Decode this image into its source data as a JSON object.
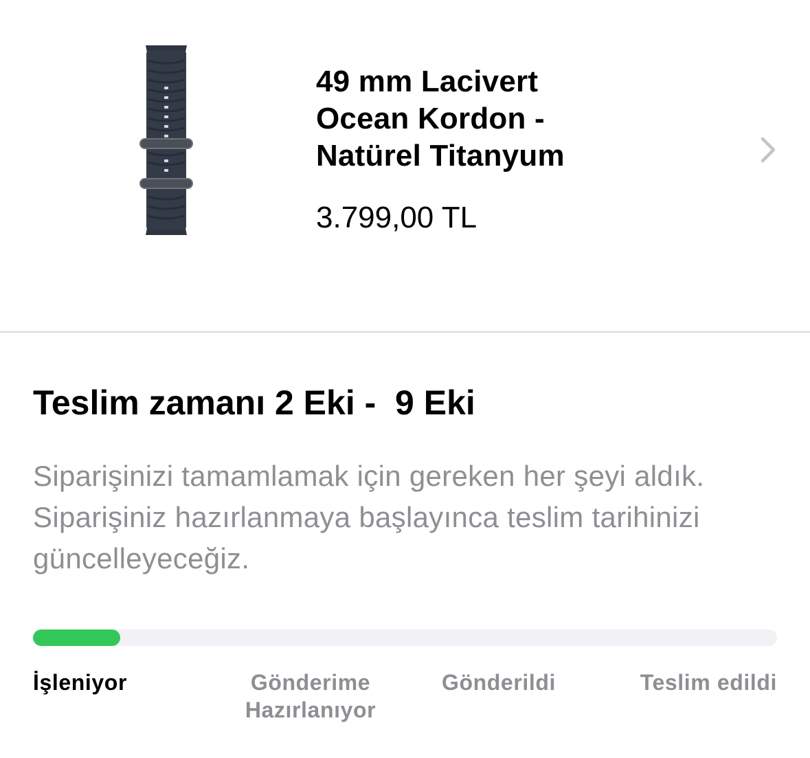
{
  "product": {
    "title_lines": [
      "49 mm Lacivert",
      "Ocean Kordon -",
      "Natürel Titanyum"
    ],
    "price": "3.799,00 TL",
    "image_icon": "watch-band-image",
    "chevron_icon": "chevron-right-icon"
  },
  "delivery": {
    "title": "Teslim zamanı 2 Eki -  9 Eki",
    "description": "Siparişinizi tamamlamak için gereken her şeyi aldık. Siparişiniz hazırlanmaya başlayınca teslim tarihinizi güncelleyeceğiz."
  },
  "progress": {
    "fraction": 0.117,
    "fill_color": "#34c759",
    "track_color": "#f1f1f6"
  },
  "steps": [
    {
      "label": "İşleniyor",
      "active": true
    },
    {
      "label": "Gönderime Hazırlanıyor",
      "active": false
    },
    {
      "label": "Gönderildi",
      "active": false
    },
    {
      "label": "Teslim edildi",
      "active": false
    }
  ],
  "colors": {
    "inactive_text": "#8e8e93",
    "divider": "#d8d8dc"
  }
}
